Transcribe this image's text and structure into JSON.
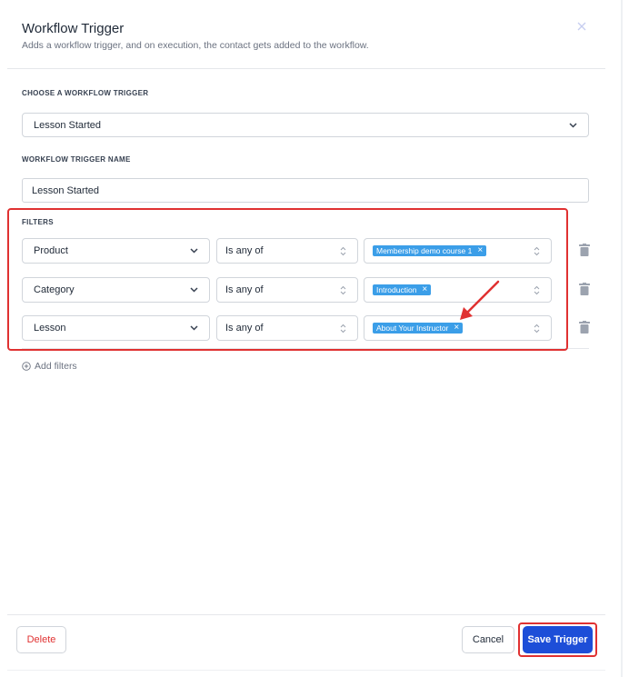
{
  "header": {
    "title": "Workflow Trigger",
    "subtitle": "Adds a workflow trigger, and on execution, the contact gets added to the workflow."
  },
  "trigger_select": {
    "label": "CHOOSE A WORKFLOW TRIGGER",
    "value": "Lesson Started"
  },
  "trigger_name": {
    "label": "WORKFLOW TRIGGER NAME",
    "value": "Lesson Started"
  },
  "filters": {
    "label": "FILTERS",
    "rows": [
      {
        "field": "Product",
        "operator": "Is any of",
        "tag": "Membership demo course 1"
      },
      {
        "field": "Category",
        "operator": "Is any of",
        "tag": "Introduction"
      },
      {
        "field": "Lesson",
        "operator": "Is any of",
        "tag": "About Your Instructor"
      }
    ],
    "add_label": "Add filters"
  },
  "footer": {
    "delete_label": "Delete",
    "cancel_label": "Cancel",
    "save_label": "Save Trigger"
  },
  "colors": {
    "primary": "#1d4ed8",
    "tag": "#3b9ee8",
    "danger": "#e03131",
    "annotation": "#e03131"
  }
}
